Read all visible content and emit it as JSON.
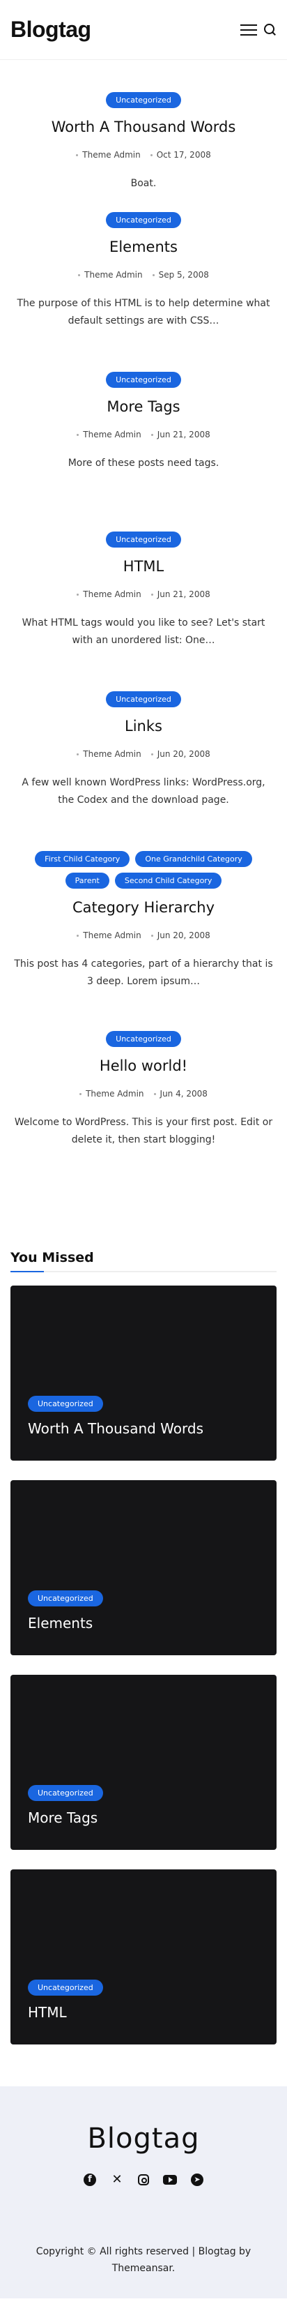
{
  "site": {
    "name": "Blogtag"
  },
  "colors": {
    "accent": "#1a66e0",
    "card_bg": "#151517",
    "footer_bg": "#eef0f7"
  },
  "header": {
    "menu_icon": "hamburger-icon",
    "search_icon": "search-icon"
  },
  "posts": [
    {
      "categories": [
        "Uncategorized"
      ],
      "title": "Worth A Thousand Words",
      "author": "Theme Admin",
      "date": "Oct 17, 2008",
      "excerpt": "Boat."
    },
    {
      "categories": [
        "Uncategorized"
      ],
      "title": "Elements",
      "author": "Theme Admin",
      "date": "Sep 5, 2008",
      "excerpt": "The purpose of this HTML is to help determine what default settings are with CSS…"
    },
    {
      "categories": [
        "Uncategorized"
      ],
      "title": "More Tags",
      "author": "Theme Admin",
      "date": "Jun 21, 2008",
      "excerpt": "More of these posts need tags."
    },
    {
      "categories": [
        "Uncategorized"
      ],
      "title": "HTML",
      "author": "Theme Admin",
      "date": "Jun 21, 2008",
      "excerpt": "What HTML tags would you like to see? Let's start with an unordered list: One…"
    },
    {
      "categories": [
        "Uncategorized"
      ],
      "title": "Links",
      "author": "Theme Admin",
      "date": "Jun 20, 2008",
      "excerpt": "A few well known WordPress links: WordPress.org, the Codex and the download page."
    },
    {
      "categories": [
        "First Child Category",
        "One Grandchild Category",
        "Parent",
        "Second Child Category"
      ],
      "title": "Category Hierarchy",
      "author": "Theme Admin",
      "date": "Jun 20, 2008",
      "excerpt": "This post has 4 categories, part of a hierarchy that is 3 deep. Lorem ipsum…"
    },
    {
      "categories": [
        "Uncategorized"
      ],
      "title": "Hello world!",
      "author": "Theme Admin",
      "date": "Jun 4, 2008",
      "excerpt": "Welcome to WordPress. This is your first post. Edit or delete it, then start blogging!"
    }
  ],
  "you_missed": {
    "heading": "You Missed",
    "items": [
      {
        "category": "Uncategorized",
        "title": "Worth A Thousand Words"
      },
      {
        "category": "Uncategorized",
        "title": "Elements"
      },
      {
        "category": "Uncategorized",
        "title": "More Tags"
      },
      {
        "category": "Uncategorized",
        "title": "HTML"
      }
    ]
  },
  "footer": {
    "brand": "Blogtag",
    "social": [
      "facebook-icon",
      "x-icon",
      "instagram-icon",
      "youtube-icon",
      "telegram-icon"
    ],
    "copyright": "Copyright © All rights reserved | Blogtag by Themeansar."
  }
}
